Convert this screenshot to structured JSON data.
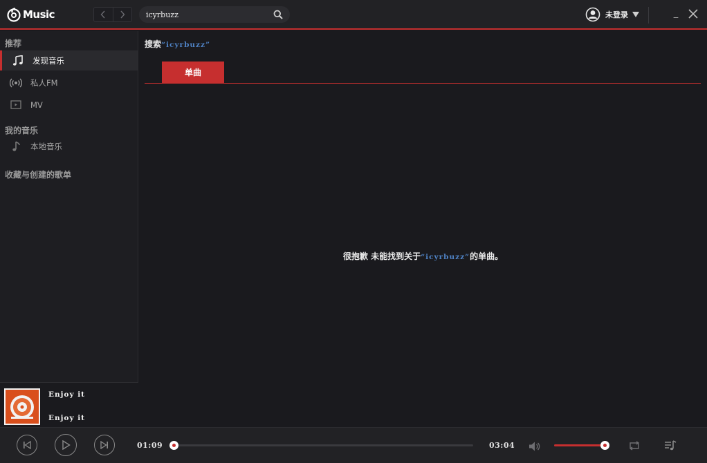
{
  "app": {
    "logo_text": "Music"
  },
  "search": {
    "value": "icyrbuzz"
  },
  "user": {
    "label": "未登录"
  },
  "window": {
    "minimize_glyph": "_"
  },
  "sidebar": {
    "section_recommend": "推荐",
    "items": [
      {
        "label": "发现音乐",
        "icon": "music-note-icon",
        "active": true
      },
      {
        "label": "私人FM",
        "icon": "radio-icon",
        "active": false
      },
      {
        "label": "MV",
        "icon": "video-icon",
        "active": false
      }
    ],
    "section_my_music": "我的音乐",
    "my_items": [
      {
        "label": "本地音乐",
        "icon": "music-note-icon"
      }
    ],
    "section_playlists": "收藏与创建的歌单"
  },
  "now_playing": {
    "title": "Enjoy it",
    "artist": "Enjoy it"
  },
  "main": {
    "heading_prefix": "搜索",
    "heading_keyword": "“icyrbuzz”",
    "tabs": [
      {
        "label": "单曲",
        "active": true
      }
    ],
    "empty_prefix": "很抱歉 未能找到关于",
    "empty_keyword": "“icyrbuzz”",
    "empty_suffix": "的单曲。"
  },
  "player": {
    "current_time": "01:09",
    "total_time": "03:04",
    "progress_fraction": 0.0,
    "volume_fraction": 1.0
  },
  "colors": {
    "accent": "#c62f2f",
    "keyword": "#4f82c4",
    "background": "#1a1a1e"
  }
}
